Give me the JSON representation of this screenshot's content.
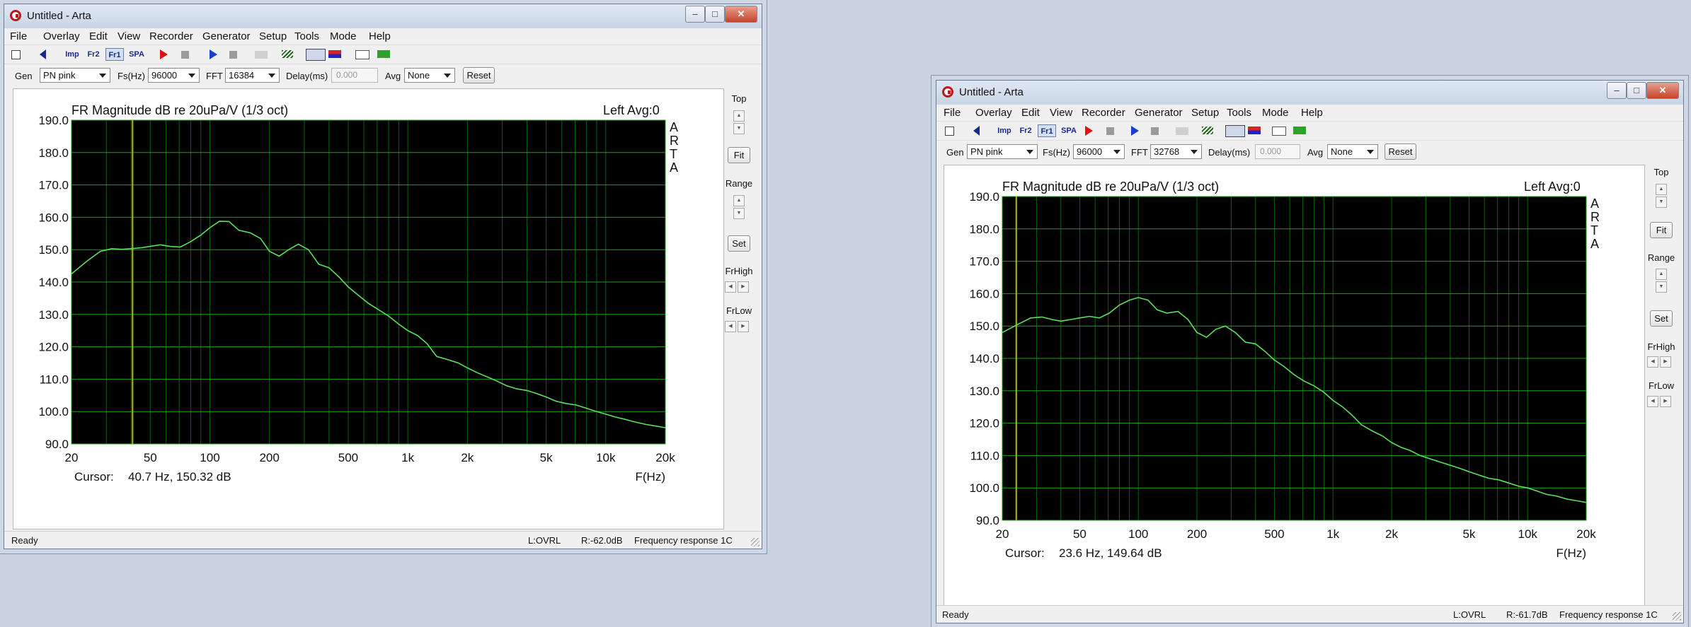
{
  "desktop": {
    "background": "#c9d3e2"
  },
  "app": {
    "title": "Untitled - Arta",
    "menu": [
      "File",
      "Overlay",
      "Edit",
      "View",
      "Recorder",
      "Generator",
      "Setup",
      "Tools",
      "Mode",
      "Help"
    ],
    "toolbar": {
      "imp_label": "Imp",
      "fr2_label": "Fr2",
      "fr1_label": "Fr1",
      "spa_label": "SPA",
      "icons": [
        "new-document-icon",
        "open-icon",
        "imp-icon",
        "fr2-icon",
        "fr1-icon",
        "spa-icon",
        "record-icon",
        "stop-icon",
        "play-icon",
        "stop2-icon",
        "abc-icon",
        "pattern-icon",
        "toggle-icon",
        "color-bar-icon",
        "scope-icon",
        "overlay-icon"
      ]
    },
    "controls": {
      "gen_label": "Gen",
      "fs_label": "Fs(Hz)",
      "fft_label": "FFT",
      "delay_label": "Delay(ms)",
      "avg_label": "Avg",
      "reset_label": "Reset"
    },
    "right_panel": {
      "top_label": "Top",
      "fit_label": "Fit",
      "range_label": "Range",
      "set_label": "Set",
      "frhigh_label": "FrHigh",
      "frlow_label": "FrLow"
    },
    "colors": {
      "plot_bg": "#000000",
      "grid": "#17a317",
      "curve": "#5ee05e",
      "cursor": "#b5b515"
    }
  },
  "windows": [
    {
      "gen_value": "PN pink",
      "fs_value": "96000",
      "fft_value": "16384",
      "delay_value": "0.000",
      "avg_value": "None",
      "status": {
        "ready": "Ready",
        "ovrl": "L:OVRL",
        "level": "R:-62.0dB",
        "mode": "Frequency response 1C"
      }
    },
    {
      "gen_value": "PN pink",
      "fs_value": "96000",
      "fft_value": "32768",
      "delay_value": "0.000",
      "avg_value": "None",
      "status": {
        "ready": "Ready",
        "ovrl": "L:OVRL",
        "level": "R:-61.7dB",
        "mode": "Frequency response 1C"
      }
    }
  ],
  "chart_data": [
    {
      "type": "line",
      "title": "FR Magnitude dB re 20uPa/V (1/3 oct)",
      "channel_label": "Left  Avg:0",
      "side_label": [
        "A",
        "R",
        "T",
        "A"
      ],
      "xlabel": "F(Hz)",
      "xscale": "log",
      "xlim": [
        20,
        20000
      ],
      "ylim": [
        90,
        190
      ],
      "x_ticks": [
        "20",
        "50",
        "100",
        "200",
        "500",
        "1k",
        "2k",
        "5k",
        "10k",
        "20k"
      ],
      "y_ticks": [
        "190.0",
        "180.0",
        "170.0",
        "160.0",
        "150.0",
        "140.0",
        "130.0",
        "120.0",
        "110.0",
        "100.0",
        "90.0"
      ],
      "grid": true,
      "cursor_label": "Cursor:",
      "cursor_value": "40.7 Hz, 150.32 dB",
      "cursor_freq": 40.7,
      "series": [
        {
          "x": [
            20,
            24,
            28,
            32,
            36,
            40,
            45,
            50,
            56,
            63,
            71,
            80,
            90,
            100,
            112,
            125,
            140,
            160,
            180,
            200,
            224,
            250,
            280,
            315,
            355,
            400,
            450,
            500,
            560,
            630,
            710,
            800,
            900,
            1000,
            1120,
            1250,
            1400,
            1600,
            1800,
            2000,
            2240,
            2500,
            2800,
            3150,
            3550,
            4000,
            4500,
            5000,
            5600,
            6300,
            7100,
            8000,
            9000,
            10000,
            11200,
            12500,
            14000,
            16000,
            18000,
            20000
          ],
          "y": [
            142.5,
            146.5,
            149.5,
            150.3,
            150.1,
            150.3,
            150.6,
            151.0,
            151.5,
            151.0,
            150.8,
            152.5,
            154.5,
            156.8,
            158.8,
            158.7,
            156.0,
            155.2,
            153.5,
            149.5,
            148.0,
            150.0,
            151.7,
            150.0,
            145.5,
            144.4,
            141.5,
            138.5,
            136.0,
            133.5,
            131.5,
            129.5,
            127.0,
            125.0,
            123.5,
            121.0,
            117.0,
            116.0,
            115.0,
            113.5,
            112.0,
            110.8,
            109.5,
            108.0,
            107.0,
            106.5,
            105.5,
            104.5,
            103.2,
            102.5,
            102.0,
            101.0,
            100.0,
            99.2,
            98.3,
            97.6,
            96.8,
            96.0,
            95.5,
            95.0
          ]
        }
      ]
    },
    {
      "type": "line",
      "title": "FR Magnitude dB re 20uPa/V (1/3 oct)",
      "channel_label": "Left  Avg:0",
      "side_label": [
        "A",
        "R",
        "T",
        "A"
      ],
      "xlabel": "F(Hz)",
      "xscale": "log",
      "xlim": [
        20,
        20000
      ],
      "ylim": [
        90,
        190
      ],
      "x_ticks": [
        "20",
        "50",
        "100",
        "200",
        "500",
        "1k",
        "2k",
        "5k",
        "10k",
        "20k"
      ],
      "y_ticks": [
        "190.0",
        "180.0",
        "170.0",
        "160.0",
        "150.0",
        "140.0",
        "130.0",
        "120.0",
        "110.0",
        "100.0",
        "90.0"
      ],
      "grid": true,
      "cursor_label": "Cursor:",
      "cursor_value": "23.6 Hz, 149.64 dB",
      "cursor_freq": 23.6,
      "series": [
        {
          "x": [
            20,
            24,
            28,
            32,
            36,
            40,
            45,
            50,
            56,
            63,
            71,
            80,
            90,
            100,
            112,
            125,
            140,
            160,
            180,
            200,
            224,
            250,
            280,
            315,
            355,
            400,
            450,
            500,
            560,
            630,
            710,
            800,
            900,
            1000,
            1120,
            1250,
            1400,
            1600,
            1800,
            2000,
            2240,
            2500,
            2800,
            3150,
            3550,
            4000,
            4500,
            5000,
            5600,
            6300,
            7100,
            8000,
            9000,
            10000,
            11200,
            12500,
            14000,
            16000,
            18000,
            20000
          ],
          "y": [
            148.0,
            150.5,
            152.5,
            152.8,
            152.0,
            151.5,
            152.0,
            152.5,
            153.0,
            152.5,
            154.0,
            156.5,
            158.0,
            158.8,
            158.0,
            155.0,
            154.0,
            154.5,
            152.0,
            148.0,
            146.5,
            149.0,
            150.0,
            148.0,
            145.0,
            144.5,
            142.0,
            139.5,
            137.5,
            135.0,
            133.0,
            131.5,
            129.5,
            127.0,
            125.0,
            122.5,
            119.5,
            117.5,
            116.0,
            114.0,
            112.5,
            111.5,
            110.0,
            109.0,
            108.0,
            107.0,
            106.0,
            105.0,
            104.0,
            103.0,
            102.5,
            101.5,
            100.5,
            100.0,
            99.0,
            98.0,
            97.5,
            96.5,
            96.0,
            95.5
          ]
        }
      ]
    }
  ]
}
